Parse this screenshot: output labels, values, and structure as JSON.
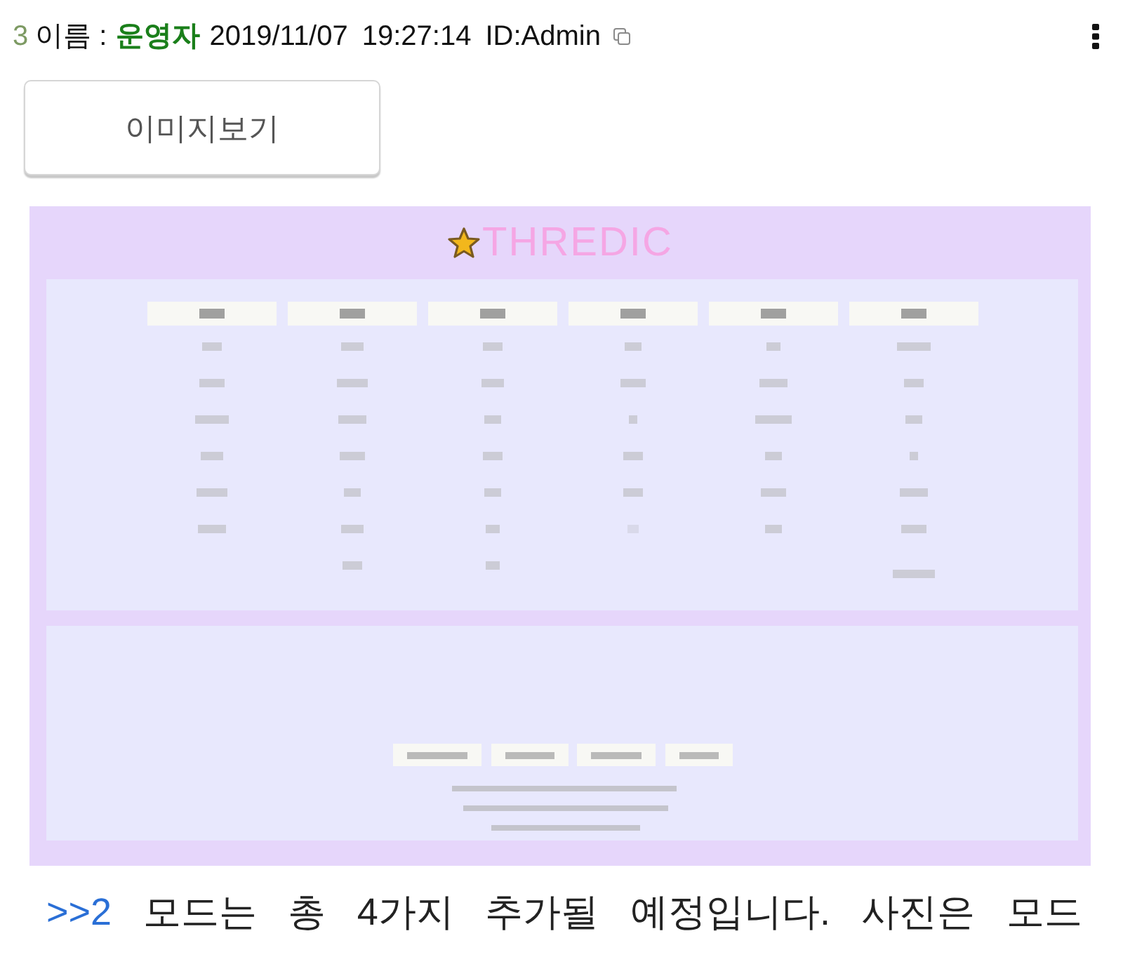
{
  "post": {
    "number": "3",
    "name_label": "이름 :",
    "author": "운영자",
    "date": "2019/11/07",
    "time": "19:27:14",
    "id": "ID:Admin"
  },
  "image_button": {
    "label": "이미지보기"
  },
  "attached_image": {
    "logo_text": "THREDIC"
  },
  "message": {
    "reply_link": ">>2",
    "text": "모드는 총 4가지 추가될 예정입니다. 사진은 모드"
  }
}
